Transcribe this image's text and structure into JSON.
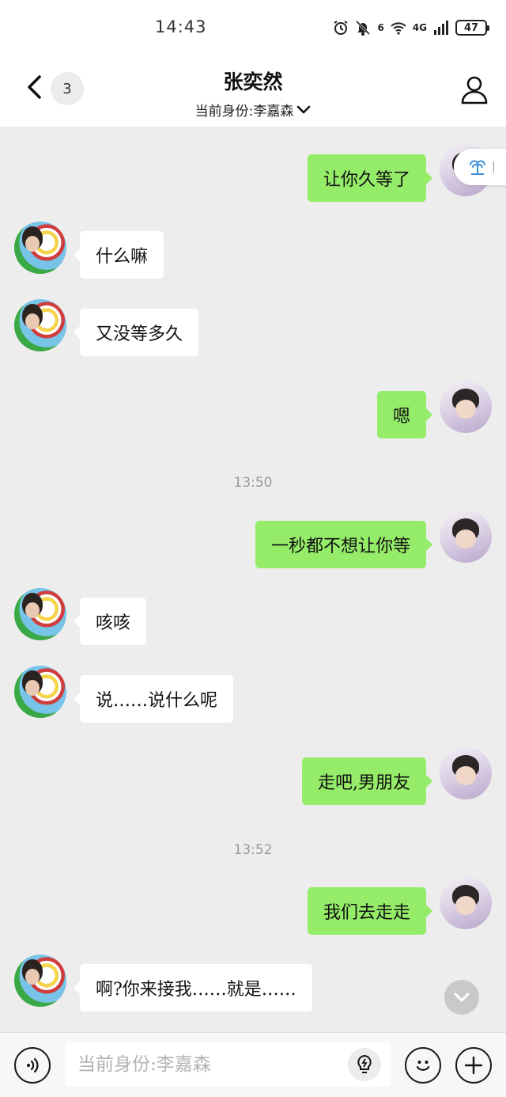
{
  "status_bar": {
    "time": "14:43",
    "network_label": "4G",
    "wifi_label": "6",
    "battery": "47"
  },
  "header": {
    "unread_count": "3",
    "title": "张奕然",
    "identity_label": "当前身份:李嘉森"
  },
  "messages": [
    {
      "side": "right",
      "text": "让你久等了"
    },
    {
      "side": "left",
      "text": "什么嘛"
    },
    {
      "side": "left",
      "text": "又没等多久"
    },
    {
      "side": "right",
      "text": "嗯"
    },
    {
      "side": "time",
      "text": "13:50"
    },
    {
      "side": "right",
      "text": "一秒都不想让你等"
    },
    {
      "side": "left",
      "text": "咳咳"
    },
    {
      "side": "left",
      "text": "说……说什么呢"
    },
    {
      "side": "right",
      "text": "走吧,男朋友"
    },
    {
      "side": "time",
      "text": "13:52"
    },
    {
      "side": "right",
      "text": "我们去走走"
    },
    {
      "side": "left",
      "text": "啊?你来接我……就是……"
    }
  ],
  "input": {
    "placeholder": "当前身份:李嘉森"
  },
  "icons": {
    "back": "chevron-left-icon",
    "profile": "person-icon",
    "voice": "voice-icon",
    "bulb": "lightbulb-icon",
    "emoji": "emoji-icon",
    "plus": "plus-icon",
    "scroll": "chevron-down-icon"
  },
  "colors": {
    "bubble_right": "#95ec69",
    "bubble_left": "#ffffff",
    "background": "#ededed"
  }
}
